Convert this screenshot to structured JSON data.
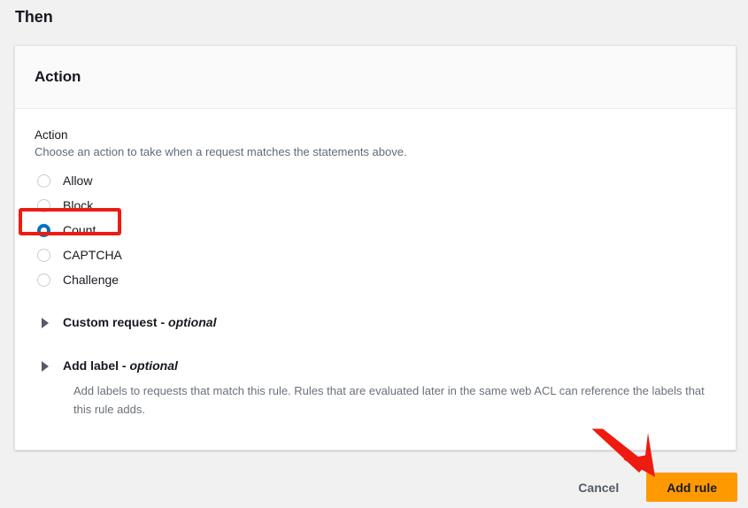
{
  "page": {
    "heading": "Then"
  },
  "card": {
    "title": "Action",
    "field": {
      "label": "Action",
      "description": "Choose an action to take when a request matches the statements above."
    },
    "radio_group": {
      "name": "action",
      "selected": "Count",
      "options": [
        {
          "label": "Allow",
          "selected": false
        },
        {
          "label": "Block",
          "selected": false
        },
        {
          "label": "Count",
          "selected": true
        },
        {
          "label": "CAPTCHA",
          "selected": false
        },
        {
          "label": "Challenge",
          "selected": false
        }
      ]
    },
    "sections": [
      {
        "title": "Custom request",
        "separator": " - ",
        "optional_label": "optional",
        "expanded": false,
        "description": ""
      },
      {
        "title": "Add label",
        "separator": " - ",
        "optional_label": "optional",
        "expanded": false,
        "description": "Add labels to requests that match this rule. Rules that are evaluated later in the same web ACL can reference the labels that this rule adds."
      }
    ]
  },
  "footer": {
    "cancel_label": "Cancel",
    "submit_label": "Add rule"
  },
  "annotations": {
    "highlight_target": "Count",
    "arrow_target": "Add rule",
    "color": "#ee1b11"
  },
  "colors": {
    "page_background": "#f1f1f1",
    "card_background": "#ffffff",
    "card_header_background": "#fafafa",
    "radio_selected": "#0073bb",
    "primary_button": "#ff9900",
    "annotation_red": "#ee1b11"
  }
}
